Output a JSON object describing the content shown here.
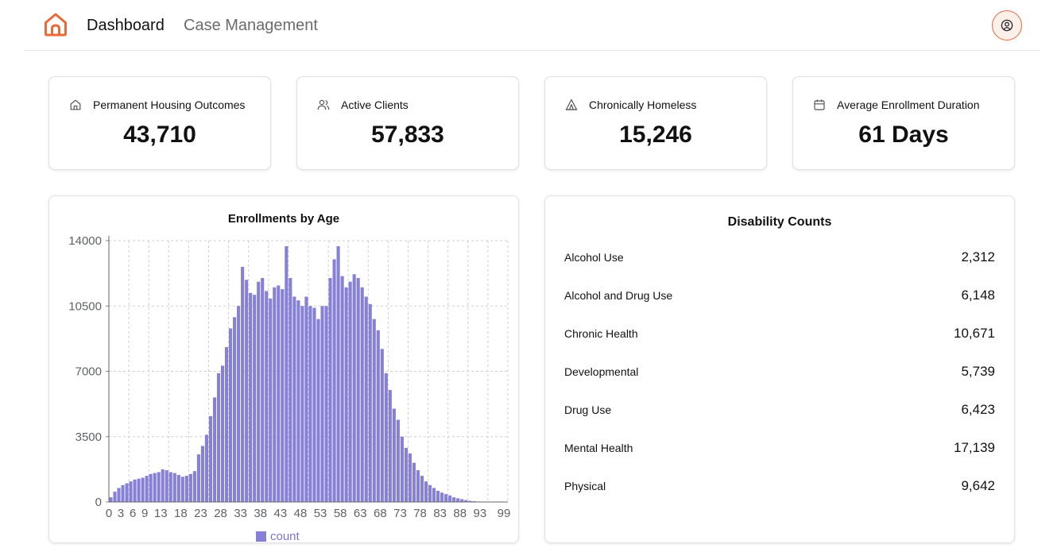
{
  "nav": {
    "logo_icon": "home-icon",
    "items": [
      {
        "label": "Dashboard",
        "active": true
      },
      {
        "label": "Case Management",
        "active": false
      }
    ],
    "user_icon": "user-circle-icon"
  },
  "colors": {
    "accent": "#ea6a3a",
    "bar": "#8680d6",
    "text": "#111111",
    "muted": "#6b6b6b"
  },
  "stats": [
    {
      "icon": "home-icon",
      "label": "Permanent Housing Outcomes",
      "value": "43,710"
    },
    {
      "icon": "users-icon",
      "label": "Active Clients",
      "value": "57,833"
    },
    {
      "icon": "tent-icon",
      "label": "Chronically Homeless",
      "value": "15,246"
    },
    {
      "icon": "calendar-icon",
      "label": "Average Enrollment Duration",
      "value": "61 Days"
    }
  ],
  "chart": {
    "title": "Enrollments by Age"
  },
  "chart_data": {
    "type": "bar",
    "title": "Enrollments by Age",
    "xlabel": "",
    "ylabel": "",
    "ylim": [
      0,
      14000
    ],
    "yticks": [
      "0",
      "3500",
      "7000",
      "10500",
      "14000"
    ],
    "xticks": [
      "0",
      "3",
      "6",
      "9",
      "13",
      "18",
      "23",
      "28",
      "33",
      "38",
      "43",
      "48",
      "53",
      "58",
      "63",
      "68",
      "73",
      "78",
      "83",
      "88",
      "93",
      "99"
    ],
    "grid": true,
    "legend": "bottom",
    "series": [
      {
        "name": "count"
      }
    ],
    "x": [
      0,
      1,
      2,
      3,
      4,
      5,
      6,
      7,
      8,
      9,
      10,
      11,
      12,
      13,
      14,
      15,
      16,
      17,
      18,
      19,
      20,
      21,
      22,
      23,
      24,
      25,
      26,
      27,
      28,
      29,
      30,
      31,
      32,
      33,
      34,
      35,
      36,
      37,
      38,
      39,
      40,
      41,
      42,
      43,
      44,
      45,
      46,
      47,
      48,
      49,
      50,
      51,
      52,
      53,
      54,
      55,
      56,
      57,
      58,
      59,
      60,
      61,
      62,
      63,
      64,
      65,
      66,
      67,
      68,
      69,
      70,
      71,
      72,
      73,
      74,
      75,
      76,
      77,
      78,
      79,
      80,
      81,
      82,
      83,
      84,
      85,
      86,
      87,
      88,
      89,
      90,
      91,
      92,
      93,
      94,
      95,
      96,
      97,
      98,
      99
    ],
    "values": [
      250,
      550,
      750,
      900,
      1000,
      1100,
      1200,
      1250,
      1300,
      1400,
      1500,
      1550,
      1600,
      1750,
      1700,
      1600,
      1550,
      1450,
      1350,
      1400,
      1500,
      1650,
      2550,
      3000,
      3600,
      4600,
      5600,
      6900,
      7300,
      8300,
      9300,
      9900,
      10500,
      12600,
      11900,
      11200,
      11100,
      11800,
      12000,
      11300,
      10900,
      11500,
      11600,
      11400,
      13700,
      12000,
      11000,
      10800,
      10500,
      11000,
      10500,
      10400,
      9800,
      10500,
      10500,
      12000,
      13000,
      13700,
      12100,
      11500,
      11800,
      12200,
      12000,
      11500,
      11000,
      10600,
      9800,
      9200,
      8200,
      6900,
      6000,
      5000,
      4400,
      3500,
      2900,
      2600,
      2100,
      1700,
      1400,
      1100,
      900,
      750,
      600,
      500,
      420,
      350,
      250,
      200,
      150,
      100,
      60,
      40,
      25,
      15,
      10,
      5,
      2,
      1,
      0,
      0
    ]
  },
  "disabilities": {
    "title": "Disability Counts",
    "items": [
      {
        "label": "Alcohol Use",
        "value": "2,312"
      },
      {
        "label": "Alcohol and Drug Use",
        "value": "6,148"
      },
      {
        "label": "Chronic Health",
        "value": "10,671"
      },
      {
        "label": "Developmental",
        "value": "5,739"
      },
      {
        "label": "Drug Use",
        "value": "6,423"
      },
      {
        "label": "Mental Health",
        "value": "17,139"
      },
      {
        "label": "Physical",
        "value": "9,642"
      }
    ]
  }
}
